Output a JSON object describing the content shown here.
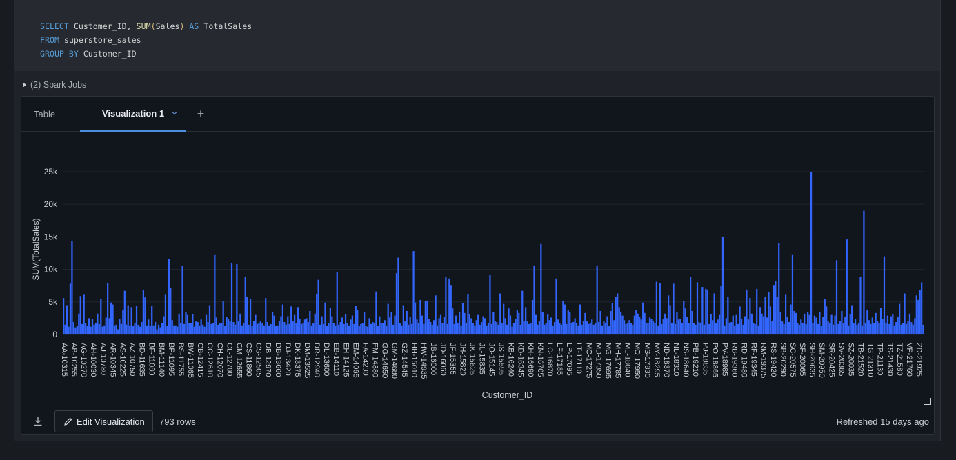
{
  "code": {
    "lines": [
      [
        {
          "t": "SELECT",
          "c": "kw"
        },
        {
          "t": " Customer_ID, ",
          "c": "id"
        },
        {
          "t": "SUM",
          "c": "fn"
        },
        {
          "t": "(",
          "c": "pn"
        },
        {
          "t": "Sales",
          "c": "id"
        },
        {
          "t": ")",
          "c": "pn"
        },
        {
          "t": " AS",
          "c": "kw"
        },
        {
          "t": " TotalSales",
          "c": "id"
        }
      ],
      [
        {
          "t": "FROM",
          "c": "kw"
        },
        {
          "t": " superstore_sales",
          "c": "id"
        }
      ],
      [
        {
          "t": "GROUP BY",
          "c": "kw"
        },
        {
          "t": " Customer_ID",
          "c": "id"
        }
      ]
    ]
  },
  "jobs": {
    "label": "(2) Spark Jobs"
  },
  "tabs": {
    "table": "Table",
    "viz": "Visualization 1",
    "add": "+"
  },
  "footer": {
    "edit": "Edit Visualization",
    "rows": "793 rows",
    "refreshed": "Refreshed 15 days ago"
  },
  "chart_data": {
    "type": "bar",
    "xlabel": "Customer_ID",
    "ylabel": "SUM(TotalSales)",
    "ylim": [
      0,
      27000
    ],
    "yticks": [
      0,
      5000,
      10000,
      15000,
      20000,
      25000
    ],
    "ytick_labels": [
      "0",
      "5k",
      "10k",
      "15k",
      "20k",
      "25k"
    ],
    "bar_color": "#3366ff",
    "tick_labels": [
      "AA-10315",
      "AB-10255",
      "AG-10270",
      "AH-10030",
      "AJ-10780",
      "AR-10345",
      "AS-10225",
      "AZ-10750",
      "BD-11635",
      "BF-11080",
      "BM-11140",
      "BP-11095",
      "BS-11755",
      "BW-11065",
      "CB-12415",
      "CC-12610",
      "CH-12070",
      "CL-12700",
      "CM-12655",
      "CS-11860",
      "CS-12505",
      "DB-12970",
      "DB-13660",
      "DJ-13420",
      "DK-13375",
      "DM-13525",
      "DR-12940",
      "DL-13600",
      "EB-14110",
      "EH-14125",
      "EM-14065",
      "FA-14230",
      "FM-14380",
      "GG-14650",
      "GM-14680",
      "GZ-14545",
      "HH-15010",
      "HW-14935",
      "JB-16000",
      "JD-16060",
      "JF-15355",
      "JH-15820",
      "JK-15625",
      "JL-15835",
      "JO-15145",
      "JS-15595",
      "KB-16240",
      "KD-16345",
      "KH-16690",
      "KN-16705",
      "LC-16870",
      "LF-17185",
      "LP-17095",
      "LT-17110",
      "MC-17275",
      "MD-17350",
      "MG-17695",
      "MH-17785",
      "ML-18040",
      "MO-17950",
      "MS-17830",
      "MY-18295",
      "ND-18370",
      "NL-18310",
      "NS-18640",
      "PB-19210",
      "PJ-18835",
      "PO-18865",
      "PV-18985",
      "RB-19360",
      "RD-19480",
      "RF-19345",
      "RM-19375",
      "RS-19420",
      "SB-20290",
      "SC-20575",
      "SF-20065",
      "SH-20635",
      "SM-20950",
      "SR-20425",
      "SV-20365",
      "SZ-20035",
      "TB-21520",
      "TG-21310",
      "TP-21130",
      "TS-21430",
      "TZ-21580",
      "VP-21760",
      "ZD-21925"
    ],
    "values": [
      5600,
      1500,
      4500,
      1200,
      7800,
      14300,
      1900,
      1100,
      1300,
      3200,
      5900,
      1600,
      6100,
      1800,
      1300,
      2500,
      1200,
      2400,
      1500,
      1700,
      3200,
      1600,
      5500,
      1200,
      1400,
      2600,
      7900,
      2500,
      4900,
      4600,
      1400,
      1500,
      800,
      2400,
      1600,
      3700,
      6700,
      1500,
      4500,
      1400,
      4200,
      1300,
      1700,
      4400,
      1500,
      1200,
      1900,
      6800,
      5700,
      1400,
      2300,
      1300,
      4400,
      1400,
      1900,
      800,
      1500,
      1100,
      1700,
      2800,
      6100,
      1300,
      11600,
      7200,
      2200,
      1400,
      1400,
      1200,
      3200,
      1800,
      10500,
      1600,
      3400,
      3000,
      1800,
      1700,
      3100,
      1200,
      2000,
      1900,
      1400,
      2300,
      1500,
      1200,
      3000,
      1900,
      4500,
      1600,
      1800,
      12200,
      2600,
      1500,
      1800,
      1700,
      5100,
      1300,
      2700,
      2400,
      2000,
      11000,
      1900,
      1500,
      10800,
      2000,
      3200,
      1400,
      1700,
      8900,
      5800,
      1500,
      5500,
      1300,
      2100,
      3000,
      1600,
      1700,
      2100,
      1800,
      1400,
      5600,
      1900,
      1400,
      1600,
      3400,
      2900,
      1300,
      1400,
      2100,
      2800,
      4600,
      1900,
      1500,
      2800,
      1600,
      4300,
      2100,
      3000,
      1800,
      4200,
      2400,
      1600,
      1800,
      2300,
      2500,
      1900,
      3600,
      1400,
      1800,
      3200,
      6200,
      8400,
      1500,
      2800,
      1600,
      4900,
      1300,
      1700,
      4100,
      2800,
      1800,
      1400,
      9600,
      1500,
      1900,
      2600,
      1600,
      3100,
      1700,
      1400,
      2300,
      2900,
      1600,
      4400,
      3700,
      1300,
      1600,
      1800,
      3500,
      1300,
      1200,
      2500,
      1600,
      1900,
      1700,
      6600,
      1300,
      2800,
      1800,
      1700,
      2200,
      1300,
      4700,
      2600,
      3400,
      1500,
      2900,
      9400,
      11800,
      1800,
      1400,
      4500,
      2000,
      3600,
      1500,
      2700,
      1600,
      12800,
      4900,
      2300,
      1800,
      5300,
      2900,
      1600,
      5100,
      5200,
      2400,
      1900,
      1500,
      2200,
      6000,
      1400,
      2500,
      3000,
      1800,
      2700,
      8800,
      1600,
      8600,
      7600,
      4000,
      1600,
      2900,
      1800,
      3500,
      1400,
      4800,
      3300,
      1800,
      6200,
      3100,
      2500,
      1700,
      1400,
      2200,
      3000,
      1500,
      1900,
      2800,
      2500,
      1400,
      1700,
      9100,
      1600,
      3400,
      2000,
      1900,
      1500,
      6300,
      1700,
      4700,
      2500,
      1500,
      4000,
      2900,
      1200,
      1800,
      2400,
      3700,
      3300,
      1500,
      6700,
      2100,
      4200,
      2000,
      1600,
      1800,
      5300,
      10600,
      3000,
      1500,
      2000,
      13900,
      3500,
      1500,
      1700,
      3100,
      2200,
      2600,
      1400,
      1900,
      8600,
      2300,
      1700,
      1500,
      5200,
      4600,
      1600,
      3800,
      3400,
      1800,
      1900,
      2500,
      1700,
      1400,
      4600,
      1500,
      2100,
      3300,
      2000,
      1600,
      1800,
      2300,
      1500,
      1700,
      10600,
      1900,
      3600,
      1400,
      2000,
      1700,
      2800,
      1300,
      3600,
      4800,
      2200,
      5800,
      6300,
      4200,
      3500,
      2900,
      2200,
      1600,
      1700,
      2200,
      1800,
      1500,
      2900,
      3700,
      3200,
      2700,
      2300,
      4900,
      3300,
      1800,
      1700,
      2600,
      2400,
      2100,
      1700,
      8100,
      1400,
      7900,
      1600,
      2400,
      3200,
      2500,
      6000,
      4500,
      1700,
      7800,
      1600,
      3400,
      2300,
      2400,
      1800,
      5100,
      4000,
      2700,
      1700,
      8900,
      3600,
      1700,
      1500,
      8000,
      1900,
      1700,
      7300,
      1500,
      7000,
      6900,
      1600,
      3100,
      2200,
      6300,
      1800,
      2300,
      3000,
      7400,
      15000,
      1400,
      2500,
      5800,
      1700,
      1900,
      2900,
      1400,
      3000,
      1600,
      4300,
      2400,
      1500,
      2800,
      6900,
      2300,
      5600,
      3200,
      1800,
      1600,
      7000,
      1400,
      4200,
      3200,
      2800,
      5800,
      2600,
      6500,
      4300,
      2100,
      7600,
      8200,
      5800,
      14000,
      3400,
      2000,
      1600,
      6100,
      2700,
      1900,
      4600,
      12200,
      3600,
      3300,
      1800,
      1500,
      2300,
      1700,
      3200,
      1600,
      3500,
      3000,
      25000,
      1700,
      2900,
      2600,
      1600,
      3500,
      1300,
      2700,
      5400,
      4300,
      2000,
      1700,
      3000,
      1500,
      2900,
      11400,
      1600,
      2100,
      3600,
      1800,
      2700,
      14600,
      1400,
      3100,
      4500,
      1700,
      2400,
      1500,
      1800,
      8900,
      1400,
      19000,
      1700,
      3800,
      2200,
      1600,
      2600,
      1800,
      3300,
      2100,
      1700,
      4100,
      2400,
      12000,
      1800,
      2900,
      1600,
      2800,
      3100,
      1400,
      1900,
      2700,
      4700,
      1500,
      1700,
      6300,
      1600,
      2000,
      3200,
      1900,
      1500,
      2500,
      6000,
      5300,
      6800,
      8000,
      1500
    ]
  }
}
